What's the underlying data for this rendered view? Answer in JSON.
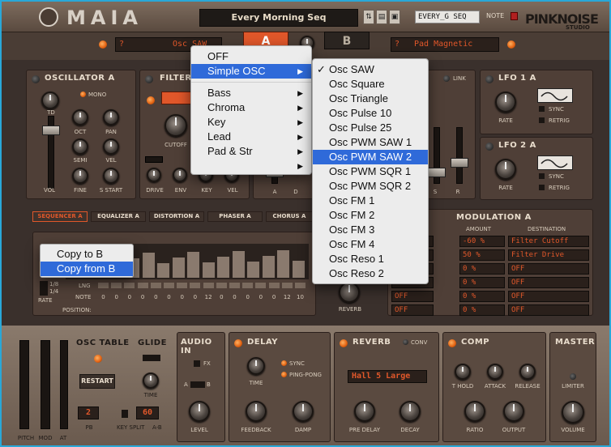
{
  "header": {
    "app_logo": "MAIA",
    "preset_name": "Every Morning Seq",
    "seq_name": "EVERY_G SEQ",
    "note_label": "NOTE",
    "brand": "PINKNOISE",
    "brand_sub": "STUDIO"
  },
  "osc_row": {
    "left_select": {
      "prefix": "?",
      "value": "Osc SAW"
    },
    "tab_a": "A",
    "tab_b": "B",
    "right_select": {
      "prefix": "?",
      "value": "Pad Magnetic"
    }
  },
  "oscillator": {
    "title": "OSCILLATOR A",
    "mono": "MONO",
    "labels": [
      "TD",
      "OCT",
      "PAN",
      "SEMI",
      "VEL",
      "VOL",
      "FINE",
      "S START"
    ]
  },
  "filter": {
    "title": "FILTER",
    "labels": [
      "CUTOFF",
      "DRIVE",
      "ENV",
      "KEY",
      "VEL"
    ]
  },
  "env_labels": [
    "A",
    "D",
    "S",
    "R"
  ],
  "link_label": "LINK",
  "lfo1": {
    "title": "LFO 1 A",
    "rate": "RATE",
    "sync": "SYNC",
    "retrig": "RETRIG"
  },
  "lfo2": {
    "title": "LFO 2 A",
    "rate": "RATE",
    "sync": "SYNC",
    "retrig": "RETRIG"
  },
  "fx_tabs": [
    "SEQUENCER A",
    "EQUALIZER A",
    "DISTORTION A",
    "PHASER A",
    "CHORUS A"
  ],
  "sequencer": {
    "rate_label": "RATE",
    "rate_options": [
      "1/8",
      "1/4"
    ],
    "lng_label": "LNG",
    "note_label": "NOTE",
    "position_label": "POSITION:",
    "note_values": [
      "0",
      "0",
      "0",
      "0",
      "0",
      "0",
      "0",
      "0",
      "12",
      "0",
      "0",
      "0",
      "0",
      "0",
      "12",
      "10"
    ]
  },
  "modulation": {
    "title": "MODULATION A",
    "headers": [
      "CE",
      "AMOUNT",
      "DESTINATION"
    ],
    "rows": [
      {
        "source": "el",
        "amount": "-60 %",
        "dest": "Filter Cutoff"
      },
      {
        "source": "el",
        "amount": "50 %",
        "dest": "Filter Drive"
      },
      {
        "source": "",
        "amount": "0 %",
        "dest": "OFF"
      },
      {
        "source": "",
        "amount": "0 %",
        "dest": "OFF"
      },
      {
        "source": "OFF",
        "amount": "0 %",
        "dest": "OFF"
      },
      {
        "source": "OFF",
        "amount": "0 %",
        "dest": "OFF"
      }
    ]
  },
  "reverb_knob_label": "REVERB",
  "bottom": {
    "wheel_labels": [
      "PITCH",
      "MOD",
      "AT"
    ],
    "osc_table": "OSC TABLE",
    "restart": "RESTART",
    "glide": "GLIDE",
    "time": "TIME",
    "pb_value": "2",
    "pb_label": "PB",
    "key_split_value": "60",
    "key_split_label": "KEY SPLIT",
    "ab_label": "A-B",
    "audio_in": "AUDIO IN",
    "fx_label": "FX",
    "level": "LEVEL",
    "a_label": "A",
    "b_label": "B",
    "delay": "DELAY",
    "delay_time": "TIME",
    "sync": "SYNC",
    "ping_pong": "PING-PONG",
    "feedback": "FEEDBACK",
    "damp": "DAMP",
    "reverb": "REVERB",
    "conv": "CONV",
    "reverb_preset": "Hall 5 Large",
    "pre_delay": "PRE DELAY",
    "decay": "DECAY",
    "comp": "COMP",
    "t_hold": "T HOLD",
    "attack": "ATTACK",
    "release": "RELEASE",
    "ratio": "RATIO",
    "output": "OUTPUT",
    "master": "MASTER",
    "limiter": "LIMITER",
    "volume": "VOLUME"
  },
  "menu_main": {
    "items": [
      {
        "label": "OFF"
      },
      {
        "label": "Simple OSC",
        "selected": true,
        "submenu": true
      },
      {
        "label": "Bass",
        "submenu": true
      },
      {
        "label": "Chroma",
        "submenu": true
      },
      {
        "label": "Key",
        "submenu": true
      },
      {
        "label": "Lead",
        "submenu": true
      },
      {
        "label": "Pad & Str",
        "submenu": true
      },
      {
        "label": "",
        "submenu": true
      }
    ]
  },
  "menu_sub": {
    "items": [
      "Osc SAW",
      "Osc Square",
      "Osc Triangle",
      "Osc Pulse 10",
      "Osc Pulse 25",
      "Osc PWM SAW 1",
      "Osc PWM SAW 2",
      "Osc PWM SQR 1",
      "Osc PWM SQR 2",
      "Osc FM 1",
      "Osc FM 2",
      "Osc FM 3",
      "Osc FM 4",
      "Osc Reso 1",
      "Osc Reso 2"
    ],
    "checked": "Osc SAW",
    "highlighted": "Osc PWM SAW 2"
  },
  "context_menu": {
    "items": [
      "Copy to B",
      "Copy from B"
    ],
    "highlighted": "Copy from B"
  },
  "colors": {
    "accent": "#e0572a",
    "menu_highlight": "#2f6ad9",
    "frame": "#29a8d8"
  }
}
